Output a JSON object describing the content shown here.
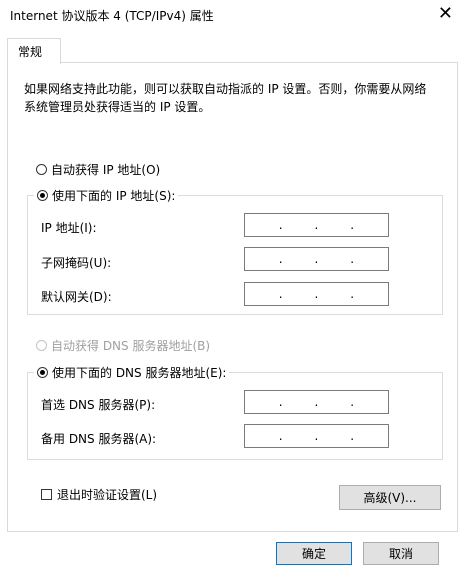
{
  "window": {
    "title": "Internet 协议版本 4 (TCP/IPv4) 属性",
    "close_glyph": "✕"
  },
  "tabs": [
    {
      "label": "常规"
    }
  ],
  "description": "如果网络支持此功能，则可以获取自动指派的 IP 设置。否则，你需要从网络系统管理员处获得适当的 IP 设置。",
  "ip": {
    "auto_label": "自动获得 IP 地址(O)",
    "manual_label": "使用下面的 IP 地址(S):",
    "selected": "manual",
    "fields": [
      {
        "label": "IP 地址(I):",
        "value": ""
      },
      {
        "label": "子网掩码(U):",
        "value": ""
      },
      {
        "label": "默认网关(D):",
        "value": ""
      }
    ]
  },
  "dns": {
    "auto_label": "自动获得 DNS 服务器地址(B)",
    "auto_disabled": true,
    "manual_label": "使用下面的 DNS 服务器地址(E):",
    "selected": "manual",
    "fields": [
      {
        "label": "首选 DNS 服务器(P):",
        "value": ""
      },
      {
        "label": "备用 DNS 服务器(A):",
        "value": ""
      }
    ]
  },
  "validate_on_exit": {
    "label": "退出时验证设置(L)",
    "checked": false
  },
  "buttons": {
    "advanced": "高级(V)...",
    "ok": "确定",
    "cancel": "取消"
  },
  "colors": {
    "field_focus_border": "#7a7a7a",
    "primary_border": "#0078d7"
  }
}
